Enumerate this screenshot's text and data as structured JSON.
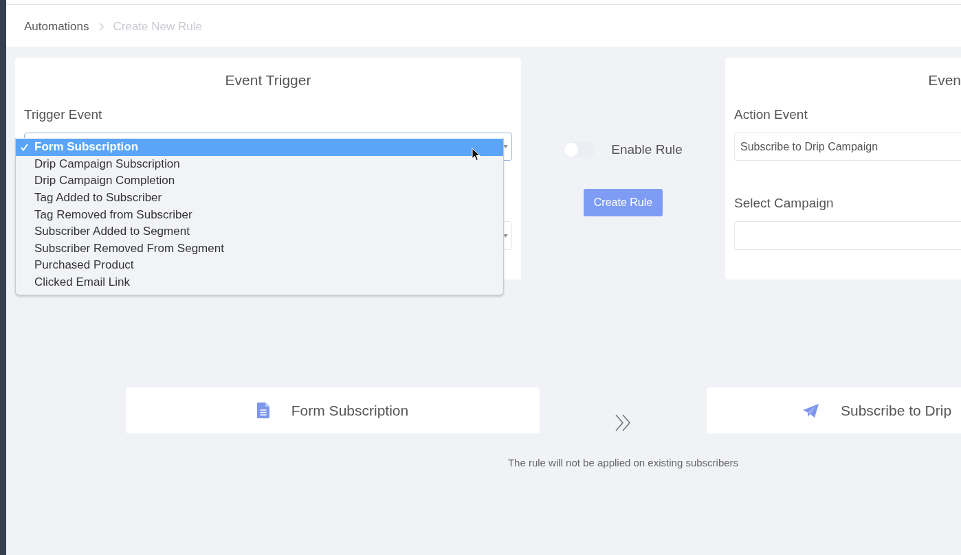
{
  "breadcrumb": [
    {
      "label": "Automations",
      "current": false
    },
    {
      "label": "Create New Rule",
      "current": true
    }
  ],
  "trigger_card": {
    "title": "Event Trigger",
    "fields": [
      {
        "label": "Trigger Event",
        "kind": "select",
        "focused": true
      },
      {
        "kind": "select",
        "focused": false
      }
    ],
    "dropdown": {
      "options": [
        {
          "label": "Form Subscription",
          "selected": true
        },
        {
          "label": "Drip Campaign Subscription",
          "selected": false
        },
        {
          "label": "Drip Campaign Completion",
          "selected": false
        },
        {
          "label": "Tag Added to Subscriber",
          "selected": false
        },
        {
          "label": "Tag Removed from Subscriber",
          "selected": false
        },
        {
          "label": "Subscriber Added to Segment",
          "selected": false
        },
        {
          "label": "Subscriber Removed From Segment",
          "selected": false
        },
        {
          "label": "Purchased Product",
          "selected": false
        },
        {
          "label": "Clicked Email Link",
          "selected": false
        }
      ]
    }
  },
  "controls": {
    "enable_rule": {
      "label": "Enable Rule",
      "on": false
    },
    "create_button": "Create Rule"
  },
  "action_card": {
    "title": "Even",
    "fields": [
      {
        "label": "Action Event",
        "kind": "text",
        "value": "Subscribe to Drip Campaign",
        "focused": false
      },
      {
        "label": "Select Campaign",
        "kind": "text",
        "focused": false
      }
    ]
  },
  "summary": {
    "trigger": "Form Subscription",
    "action": "Subscribe to Drip"
  },
  "note": "The rule will not be applied on existing subscribers"
}
